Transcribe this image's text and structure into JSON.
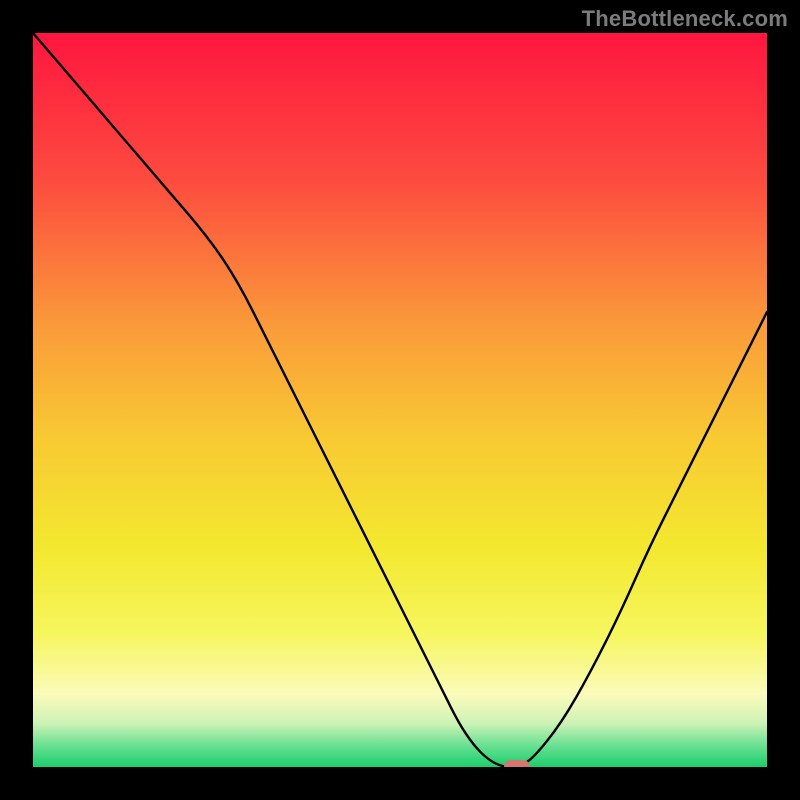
{
  "watermark": "TheBottleneck.com",
  "chart_data": {
    "type": "line",
    "title": "",
    "xlabel": "",
    "ylabel": "",
    "xlim": [
      0,
      100
    ],
    "ylim": [
      0,
      100
    ],
    "grid": false,
    "legend": false,
    "series": [
      {
        "name": "bottleneck-curve",
        "x": [
          0,
          6,
          12,
          18,
          24,
          28,
          32,
          36,
          40,
          44,
          48,
          52,
          56,
          58,
          60,
          62,
          64,
          66,
          68,
          72,
          76,
          80,
          84,
          88,
          92,
          96,
          100
        ],
        "y": [
          100,
          93,
          86,
          79,
          72,
          66,
          58,
          50,
          42,
          34,
          26,
          18,
          10,
          6,
          3,
          1,
          0,
          0,
          1,
          6,
          13,
          21,
          30,
          38,
          46,
          54,
          62
        ]
      }
    ],
    "marker": {
      "x": 66,
      "y": 0,
      "color": "#d5766f"
    },
    "background_gradient": {
      "type": "vertical",
      "stops": [
        {
          "pos": 0.0,
          "color": "#fe163f"
        },
        {
          "pos": 0.2,
          "color": "#fd4b3f"
        },
        {
          "pos": 0.4,
          "color": "#fa9b3a"
        },
        {
          "pos": 0.55,
          "color": "#f8c933"
        },
        {
          "pos": 0.7,
          "color": "#f3e82f"
        },
        {
          "pos": 0.82,
          "color": "#f6f65f"
        },
        {
          "pos": 0.9,
          "color": "#fbfbba"
        },
        {
          "pos": 0.94,
          "color": "#cff2b7"
        },
        {
          "pos": 0.97,
          "color": "#6be193"
        },
        {
          "pos": 1.0,
          "color": "#1bce6c"
        }
      ]
    }
  }
}
